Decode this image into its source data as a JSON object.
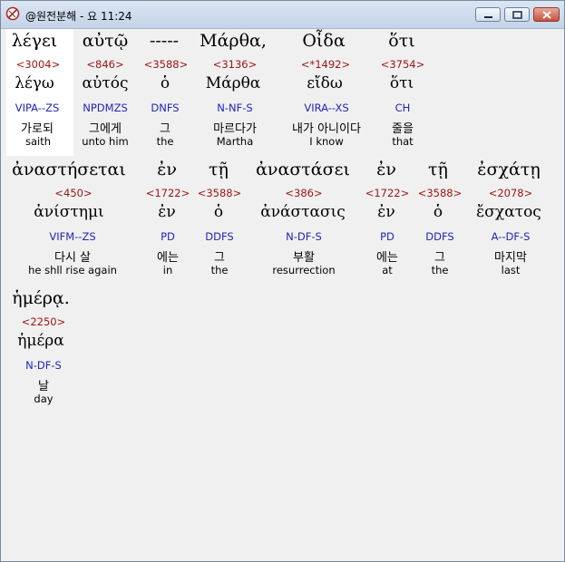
{
  "window": {
    "title": "@원전분해 - 요 11:24"
  },
  "rows": [
    {
      "words": [
        {
          "word": "λέγει",
          "strongs": "<3004>",
          "lemma": "λέγω",
          "parse": "VIPA--ZS",
          "korean": "가로되",
          "english": "saith"
        },
        {
          "word": "αὐτῷ",
          "strongs": "<846>",
          "lemma": "αὐτός",
          "parse": "NPDMZS",
          "korean": "그에게",
          "english": "unto him"
        },
        {
          "word": "-----",
          "strongs": "<3588>",
          "lemma": "ὁ",
          "parse": "DNFS",
          "korean": "그",
          "english": "the"
        },
        {
          "word": "Μάρθα,",
          "strongs": "<3136>",
          "lemma": "Μάρθα",
          "parse": "N-NF-S",
          "korean": "마르다가",
          "english": "Martha"
        },
        {
          "word": "Οἶδα",
          "strongs": "<*1492>",
          "lemma": "εἴδω",
          "parse": "VIRA--XS",
          "korean": "내가 아니이다",
          "english": "I know"
        },
        {
          "word": "ὅτι",
          "strongs": "<3754>",
          "lemma": "ὅτι",
          "parse": "CH",
          "korean": "줄을",
          "english": "that"
        }
      ]
    },
    {
      "words": [
        {
          "word": "ἀναστήσεται",
          "strongs": "<450>",
          "lemma": "ἀνίστημι",
          "parse": "VIFM--ZS",
          "korean": "다시 살",
          "english": "he shll rise again"
        },
        {
          "word": "ἐν",
          "strongs": "<1722>",
          "lemma": "ἐν",
          "parse": "PD",
          "korean": "에는",
          "english": "in"
        },
        {
          "word": "τῇ",
          "strongs": "<3588>",
          "lemma": "ὁ",
          "parse": "DDFS",
          "korean": "그",
          "english": "the"
        },
        {
          "word": "ἀναστάσει",
          "strongs": "<386>",
          "lemma": "ἀνάστασις",
          "parse": "N-DF-S",
          "korean": "부활",
          "english": "resurrection"
        },
        {
          "word": "ἐν",
          "strongs": "<1722>",
          "lemma": "ἐν",
          "parse": "PD",
          "korean": "에는",
          "english": "at"
        },
        {
          "word": "τῇ",
          "strongs": "<3588>",
          "lemma": "ὁ",
          "parse": "DDFS",
          "korean": "그",
          "english": "the"
        },
        {
          "word": "ἐσχάτῃ",
          "strongs": "<2078>",
          "lemma": "ἔσχατος",
          "parse": "A--DF-S",
          "korean": "마지막",
          "english": "last"
        }
      ]
    },
    {
      "words": [
        {
          "word": "ἡμέρᾳ.",
          "strongs": "<2250>",
          "lemma": "ἡμέρα",
          "parse": "N-DF-S",
          "korean": "날",
          "english": "day"
        }
      ]
    }
  ]
}
